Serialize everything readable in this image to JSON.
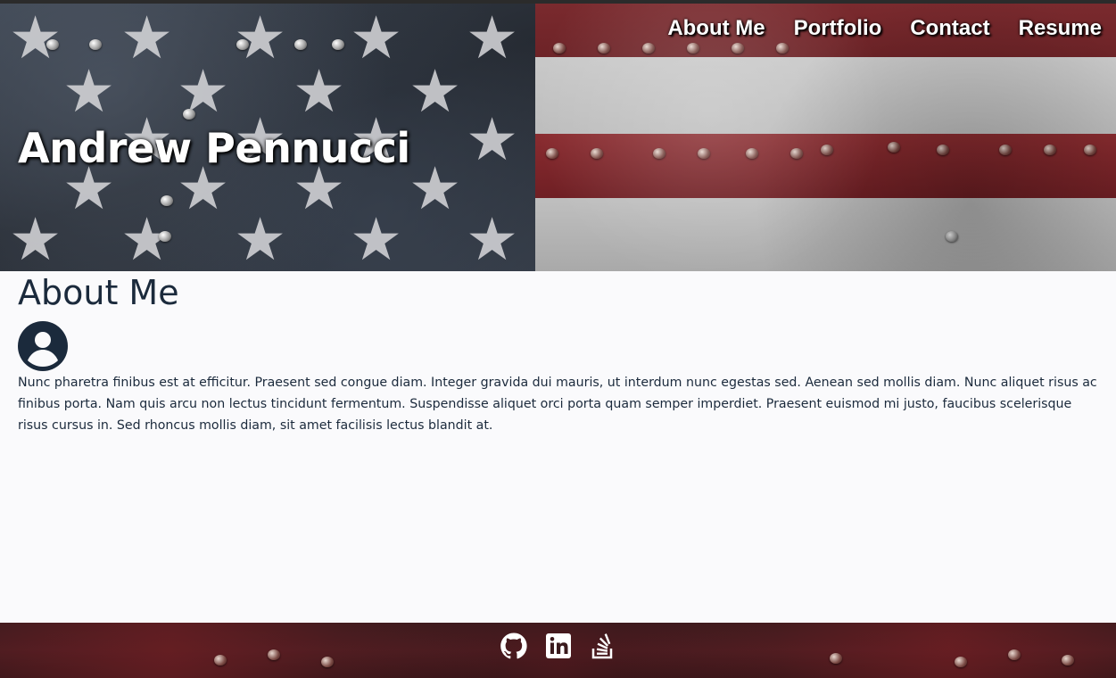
{
  "header": {
    "title": "Andrew Pennucci",
    "nav": [
      {
        "label": "About Me"
      },
      {
        "label": "Portfolio"
      },
      {
        "label": "Contact"
      },
      {
        "label": "Resume"
      }
    ]
  },
  "main": {
    "section_title": "About Me",
    "avatar_icon": "user-circle-icon",
    "bio": "Nunc pharetra finibus est at efficitur. Praesent sed congue diam. Integer gravida dui mauris, ut interdum nunc egestas sed. Aenean sed mollis diam. Nunc aliquet risus ac finibus porta. Nam quis arcu non lectus tincidunt fermentum. Suspendisse aliquet orci porta quam semper imperdiet. Praesent euismod mi justo, faucibus scelerisque risus cursus in. Sed rhoncus mollis diam, sit amet facilisis lectus blandit at."
  },
  "footer": {
    "icons": [
      "github-icon",
      "linkedin-icon",
      "stackoverflow-icon"
    ]
  },
  "colors": {
    "text_dark": "#1b2a3c",
    "page_bg": "#fafafc",
    "nav_text": "#ffffff"
  }
}
